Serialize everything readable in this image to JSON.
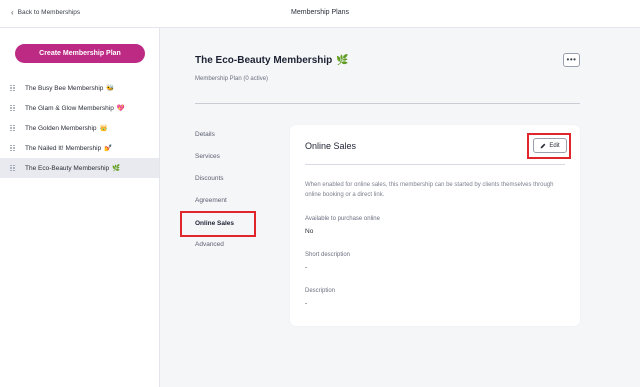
{
  "header": {
    "back_label": "Back to Memberships",
    "title": "Membership Plans"
  },
  "sidebar": {
    "create_button": "Create Membership Plan",
    "plans": [
      {
        "name": "The Busy Bee Membership",
        "emoji": "🐝"
      },
      {
        "name": "The Glam & Glow Membership",
        "emoji": "💖"
      },
      {
        "name": "The Golden Membership",
        "emoji": "👑"
      },
      {
        "name": "The Nailed It! Membership",
        "emoji": "💅"
      },
      {
        "name": "The Eco-Beauty Membership",
        "emoji": "🌿"
      }
    ]
  },
  "plan": {
    "title": "The Eco-Beauty Membership",
    "title_emoji": "🌿",
    "subtitle": "Membership Plan (0 active)",
    "more_label": "•••"
  },
  "sections": [
    "Details",
    "Services",
    "Discounts",
    "Agreement",
    "Online Sales",
    "Advanced"
  ],
  "active_section": "Online Sales",
  "card": {
    "title": "Online Sales",
    "edit_label": "Edit",
    "edit_icon": "pencil-icon",
    "description": "When enabled for online sales, this membership can be started by clients themselves through online booking or a direct link.",
    "fields": [
      {
        "label": "Available to purchase online",
        "value": "No"
      },
      {
        "label": "Short description",
        "value": "-"
      },
      {
        "label": "Description",
        "value": "-"
      }
    ]
  },
  "colors": {
    "accent": "#bd2a83",
    "highlight": "#e0262a"
  }
}
